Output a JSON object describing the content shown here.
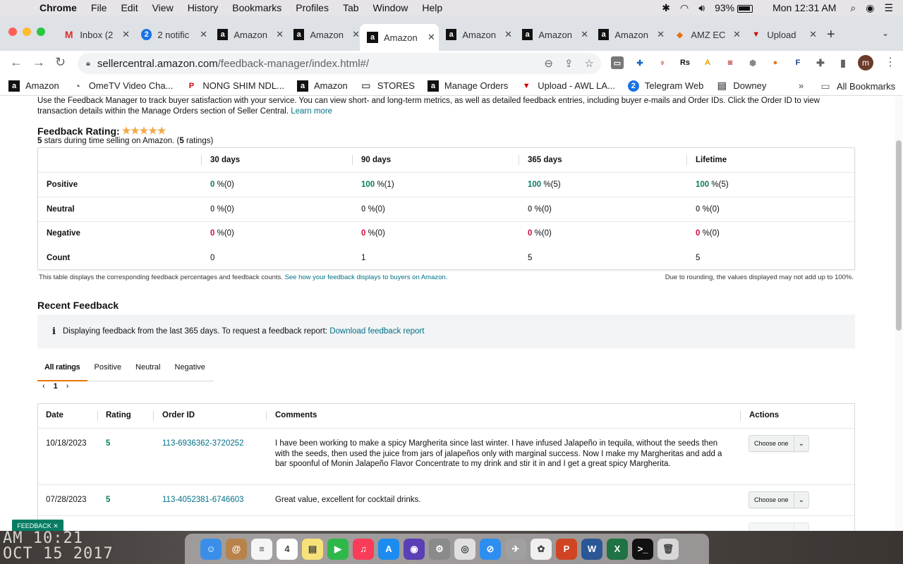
{
  "menubar": {
    "app": "Chrome",
    "items": [
      "File",
      "Edit",
      "View",
      "History",
      "Bookmarks",
      "Profiles",
      "Tab",
      "Window",
      "Help"
    ],
    "battery": "93%",
    "clock": "Mon 12:31 AM"
  },
  "tabs": [
    {
      "title": "Inbox (2",
      "icon": "gmail-icon",
      "glyph": "M"
    },
    {
      "title": "2 notific",
      "icon": "notification-icon",
      "glyph": "2"
    },
    {
      "title": "Amazon",
      "icon": "amazon-icon",
      "glyph": "a"
    },
    {
      "title": "Amazon",
      "icon": "amazon-icon",
      "glyph": "a"
    },
    {
      "title": "Amazon",
      "icon": "amazon-icon",
      "glyph": "a",
      "active": true
    },
    {
      "title": "Amazon",
      "icon": "amazon-icon",
      "glyph": "a"
    },
    {
      "title": "Amazon",
      "icon": "amazon-icon",
      "glyph": "a"
    },
    {
      "title": "Amazon",
      "icon": "amazon-icon",
      "glyph": "a"
    },
    {
      "title": "AMZ EC",
      "icon": "amz-ec-icon",
      "glyph": "◆"
    },
    {
      "title": "Upload",
      "icon": "upload-icon",
      "glyph": "▼"
    }
  ],
  "address": {
    "domain": "sellercentral.amazon.com",
    "path": "/feedback-manager/index.html#/"
  },
  "bookmarks": [
    {
      "label": "Amazon",
      "icon": "amazon-icon",
      "glyph": "a",
      "cls": "amz"
    },
    {
      "label": "OmeTV Video Cha...",
      "icon": "ometv-icon",
      "glyph": "◔",
      "cls": "fold"
    },
    {
      "label": "NONG SHIM NDL...",
      "icon": "pinterest-icon",
      "glyph": "P",
      "cls": "red"
    },
    {
      "label": "Amazon",
      "icon": "amazon-icon",
      "glyph": "a",
      "cls": "amz"
    },
    {
      "label": "STORES",
      "icon": "folder-icon",
      "glyph": "▭",
      "cls": "fold"
    },
    {
      "label": "Manage Orders",
      "icon": "amazon-icon",
      "glyph": "a",
      "cls": "amz"
    },
    {
      "label": "Upload - AWL LA...",
      "icon": "upload-icon",
      "glyph": "▼",
      "cls": "red"
    },
    {
      "label": "Telegram Web",
      "icon": "telegram-icon",
      "glyph": "2",
      "cls": "blue"
    },
    {
      "label": "Downey",
      "icon": "sheets-icon",
      "glyph": "▤",
      "cls": "fold"
    }
  ],
  "bookmarks_all": "All Bookmarks",
  "intro": {
    "text": "Use the Feedback Manager to track buyer satisfaction with your service. You can view short- and long-term metrics, as well as detailed feedback entries, including buyer e-mails and Order IDs. Click the Order ID to view transaction details within the Manage Orders section of Seller Central.",
    "link": "Learn more"
  },
  "rating": {
    "title": "Feedback Rating:",
    "stars": 5,
    "stars_glyph": "★★★★★",
    "sub_num": "5",
    "sub_text": " stars during time selling on Amazon. (",
    "sub_count": "5",
    "sub_end": " ratings)"
  },
  "feedback_table": {
    "columns": [
      "30 days",
      "90 days",
      "365 days",
      "Lifetime"
    ],
    "rows": [
      {
        "label": "Positive",
        "cells": [
          {
            "v": "0",
            "c": "(0)",
            "color": "green"
          },
          {
            "v": "100",
            "c": "(1)",
            "color": "green"
          },
          {
            "v": "100",
            "c": "(5)",
            "color": "green"
          },
          {
            "v": "100",
            "c": "(5)",
            "color": "green"
          }
        ]
      },
      {
        "label": "Neutral",
        "cells": [
          {
            "v": "0",
            "c": "(0)",
            "color": "gray"
          },
          {
            "v": "0",
            "c": "(0)",
            "color": "gray"
          },
          {
            "v": "0",
            "c": "(0)",
            "color": "gray"
          },
          {
            "v": "0",
            "c": "(0)",
            "color": "gray"
          }
        ]
      },
      {
        "label": "Negative",
        "cells": [
          {
            "v": "0",
            "c": "(0)",
            "color": "red"
          },
          {
            "v": "0",
            "c": "(0)",
            "color": "red"
          },
          {
            "v": "0",
            "c": "(0)",
            "color": "red"
          },
          {
            "v": "0",
            "c": "(0)",
            "color": "red"
          }
        ]
      }
    ],
    "count_label": "Count",
    "counts": [
      "0",
      "1",
      "5",
      "5"
    ],
    "note": "This table displays the corresponding feedback percentages and feedback counts.",
    "note_link": "See how your feedback displays to buyers on Amazon.",
    "note_right": "Due to rounding, the values displayed may not add up to 100%."
  },
  "recent": {
    "title": "Recent Feedback",
    "info": "Displaying feedback from the last 365 days. To request a feedback report:",
    "info_link": "Download feedback report",
    "tabs": [
      "All ratings",
      "Positive",
      "Neutral",
      "Negative"
    ],
    "page": "1",
    "headers": [
      "Date",
      "Rating",
      "Order ID",
      "Comments",
      "Actions"
    ],
    "rows": [
      {
        "date": "10/18/2023",
        "rating": "5",
        "order": "113-6936362-3720252",
        "comment": "I have been working to make a spicy Margherita since last winter. I have infused Jalapeño in tequila, without the seeds then with the seeds, then used the juice from jars of jalapeños only with marginal success. Now I make my Margheritas and add a bar spoonful of Monin Jalapeño Flavor Concentrate to my drink and stir it in and I get a great spicy Margherita.",
        "action": "Choose one"
      },
      {
        "date": "07/28/2023",
        "rating": "5",
        "order": "113-4052381-6746603",
        "comment": "Great value, excellent for cocktail drinks.",
        "action": "Choose one"
      }
    ]
  },
  "feedback_button": "FEEDBACK ✕",
  "desktop_clock": {
    "line1": "AM 10:21",
    "line2": "OCT 15 2017"
  },
  "dock_apps": [
    {
      "name": "finder-icon",
      "bg": "#3b8ee8",
      "glyph": "☺"
    },
    {
      "name": "contacts-icon",
      "bg": "#b7834a",
      "glyph": "@"
    },
    {
      "name": "reminders-icon",
      "bg": "#f5f5f5",
      "glyph": "≡"
    },
    {
      "name": "calendar-icon",
      "bg": "#ffffff",
      "glyph": "4"
    },
    {
      "name": "notes-icon",
      "bg": "#f7e27a",
      "glyph": "▤"
    },
    {
      "name": "facetime-icon",
      "bg": "#2fb84a",
      "glyph": "▶"
    },
    {
      "name": "music-icon",
      "bg": "#fa3c5a",
      "glyph": "♫"
    },
    {
      "name": "appstore-icon",
      "bg": "#1d8cf0",
      "glyph": "A"
    },
    {
      "name": "siri-icon",
      "bg": "#5a3fb5",
      "glyph": "◉"
    },
    {
      "name": "settings-icon",
      "bg": "#8a8a8a",
      "glyph": "⚙"
    },
    {
      "name": "chrome-icon",
      "bg": "#e0e0e0",
      "glyph": "◎"
    },
    {
      "name": "safari-icon",
      "bg": "#2d8ef0",
      "glyph": "⊘"
    },
    {
      "name": "launchpad-icon",
      "bg": "#a0a0a0",
      "glyph": "✈"
    },
    {
      "name": "photos-icon",
      "bg": "#f0f0f0",
      "glyph": "✿"
    },
    {
      "name": "powerpoint-icon",
      "bg": "#d04423",
      "glyph": "P"
    },
    {
      "name": "word-icon",
      "bg": "#2b5797",
      "glyph": "W"
    },
    {
      "name": "excel-icon",
      "bg": "#1f7244",
      "glyph": "X"
    },
    {
      "name": "terminal-icon",
      "bg": "#111111",
      "glyph": ">_"
    },
    {
      "name": "trash-icon",
      "bg": "#d8d8d8",
      "glyph": "🗑"
    }
  ]
}
